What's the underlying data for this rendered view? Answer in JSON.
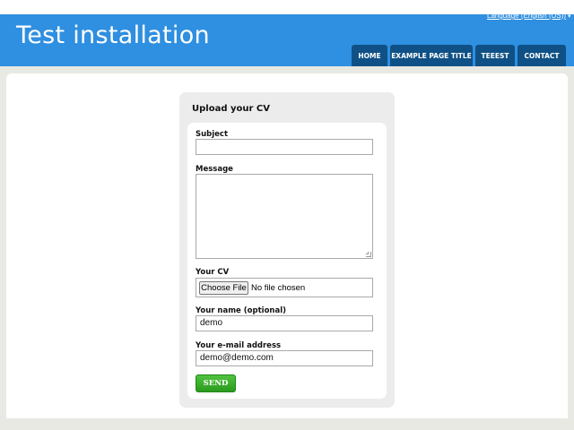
{
  "site": {
    "title": "Test installation",
    "language_link": "Language (English (US))",
    "language_caret": "▾"
  },
  "nav": {
    "items": [
      {
        "label": "HOME"
      },
      {
        "label": "EXAMPLE PAGE TITLE"
      },
      {
        "label": "TEEEST"
      },
      {
        "label": "CONTACT"
      }
    ]
  },
  "form": {
    "title": "Upload your CV",
    "subject": {
      "label": "Subject",
      "value": ""
    },
    "message": {
      "label": "Message",
      "value": ""
    },
    "cv": {
      "label": "Your CV",
      "button": "Choose File",
      "status": "No file chosen"
    },
    "name": {
      "label": "Your name (optional)",
      "value": "demo"
    },
    "email": {
      "label": "Your e-mail address",
      "value": "demo@demo.com"
    },
    "send_label": "SEND"
  },
  "colors": {
    "header": "#2f8fe0",
    "nav": "#0f5186",
    "send": "#3cb22e"
  }
}
